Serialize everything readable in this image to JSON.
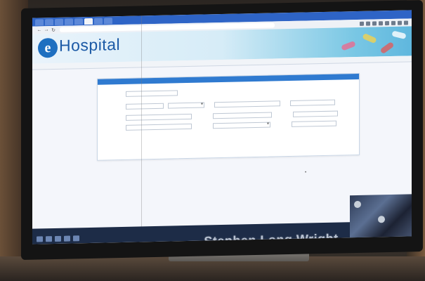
{
  "browser": {
    "tabs": [
      "",
      "",
      "",
      "",
      "",
      "",
      "",
      ""
    ],
    "active_tab_index": 5,
    "url": ""
  },
  "banner": {
    "logo_letter": "e",
    "logo_text": "Hospital",
    "logo_sub": "",
    "tagline": ""
  },
  "menu": {
    "items": [
      "",
      "",
      "",
      "",
      "",
      ""
    ],
    "active_index": 1,
    "right_text": ""
  },
  "form": {
    "title": "",
    "rows": [
      {
        "label": "",
        "values": [
          ""
        ]
      },
      {
        "label": "",
        "values": [
          "",
          "",
          "",
          ""
        ]
      },
      {
        "label": "",
        "values": [
          "",
          "",
          ""
        ]
      },
      {
        "label": "",
        "values": [
          "",
          "",
          ""
        ]
      },
      {
        "label": "",
        "values": []
      }
    ],
    "note": ""
  },
  "taskbar": {
    "caption": ""
  },
  "overlay": {
    "speaker_name": "Stephen Long Wright"
  },
  "colors": {
    "accent": "#2f7ad0",
    "banner_blue": "#1c5aa6",
    "tabbar": "#2e64c6",
    "taskbar": "#1d2c47"
  },
  "icons": [
    "back-icon",
    "forward-icon",
    "reload-icon",
    "extension-icon",
    "mouse-cursor-icon"
  ]
}
